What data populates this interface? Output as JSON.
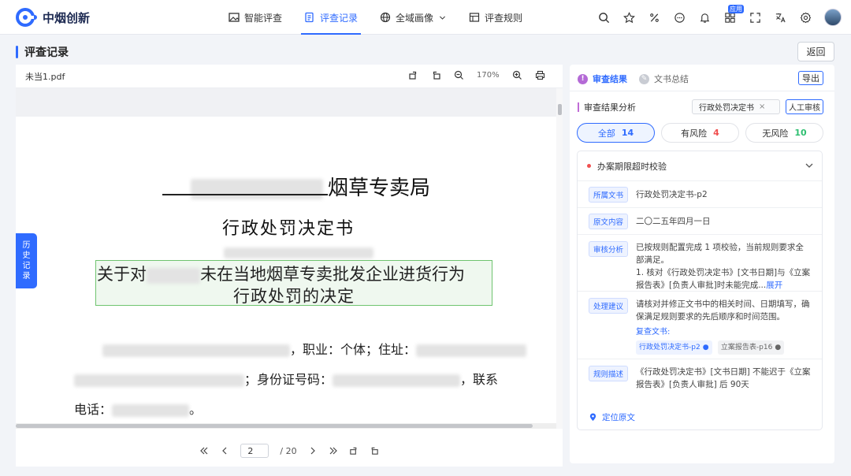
{
  "app": {
    "logo_text": "中烟创新"
  },
  "nav": [
    {
      "label": "智能评查",
      "icon": "image-icon"
    },
    {
      "label": "评查记录",
      "icon": "record-icon",
      "active": true
    },
    {
      "label": "全域画像",
      "icon": "globe-icon"
    },
    {
      "label": "评查规则",
      "icon": "rules-icon"
    }
  ],
  "toolbar": {
    "app_badge": "应用"
  },
  "page": {
    "title": "评查记录",
    "back_label": "返回"
  },
  "viewer": {
    "file_name": "未当1.pdf",
    "zoom": "170%",
    "doc": {
      "heading_suffix": "烟草专卖局",
      "doc_title": "行政处罚决定书",
      "highlight_line1_a": "关于对",
      "highlight_line1_b": "未在当地烟草专卖批发企业进货行为",
      "highlight_line2": "行政处罚的决定",
      "body1_mid": "，职业：个体；住址：",
      "body2_mid": "；身份证号码：",
      "body2_end": "，联系",
      "body3_a": "电话：",
      "body3_end": "。"
    },
    "pager": {
      "current": "2",
      "total": "/ 20"
    }
  },
  "history_tab": [
    "历",
    "史",
    "记",
    "录"
  ],
  "panel": {
    "tab_result": "审查结果",
    "tab_summary": "文书总结",
    "export_label": "导出",
    "section_title": "审查结果分析",
    "tag": "行政处罚决定书",
    "manual_label": "人工审核",
    "filters": [
      {
        "label": "全部",
        "count": "14",
        "color": "#2f6bff"
      },
      {
        "label": "有风险",
        "count": "4",
        "color": "#f05050"
      },
      {
        "label": "无风险",
        "count": "10",
        "color": "#2fbf71"
      }
    ],
    "card": {
      "title": "办案期限超时校验",
      "rows": {
        "doc": {
          "label": "所属文书",
          "value": "行政处罚决定书-p2"
        },
        "orig": {
          "label": "原文内容",
          "value": "二〇二五年四月一日"
        },
        "analysis": {
          "label": "审核分析",
          "line1": "已按规则配置完成 1 项校验，当前规则要求全部满足。",
          "line2": "1. 核对《行政处罚决定书》[文书日期]与《立案报告表》[负责人审批]时未能完成...",
          "more": "展开"
        },
        "suggest": {
          "label": "处理建议",
          "value": "请核对并修正文书中的相关时间、日期填写，确保满足规则要求的先后顺序和时间范围。",
          "review_label": "复查文书:",
          "chip1": "行政处罚决定书-p2",
          "chip2": "立案报告表-p16"
        },
        "rule": {
          "label": "规则描述",
          "value": "《行政处罚决定书》[文书日期] 不能迟于《立案报告表》[负责人审批] 后 90天"
        }
      },
      "locate_label": "定位原文"
    }
  }
}
